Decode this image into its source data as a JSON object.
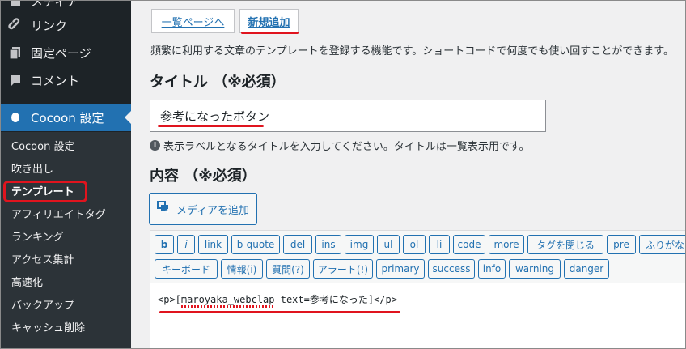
{
  "sidebar": {
    "menu": {
      "cut": "メディア",
      "link": "リンク",
      "page": "固定ページ",
      "comment": "コメント",
      "cocoon": "Cocoon 設定"
    },
    "submenu": [
      "Cocoon 設定",
      "吹き出し",
      "テンプレート",
      "アフィリエイトタグ",
      "ランキング",
      "アクセス集計",
      "高速化",
      "バックアップ",
      "キャッシュ削除"
    ]
  },
  "tabs": {
    "list": "一覧ページへ",
    "new": "新規追加"
  },
  "description": "頻繁に利用する文章のテンプレートを登録する機能です。ショートコードで何度でも使い回すことができます。",
  "title_field": {
    "heading": "タイトル （※必須）",
    "value": "参考になったボタン",
    "hint": "表示ラベルとなるタイトルを入力してください。タイトルは一覧表示用です。"
  },
  "content_field": {
    "heading": "内容 （※必須）",
    "media_button": "メディアを追加",
    "toolbar_row1": [
      "b",
      "i",
      "link",
      "b-quote",
      "del",
      "ins",
      "img",
      "ul",
      "ol",
      "li",
      "code",
      "more",
      "タグを閉じる",
      "pre",
      "ふりがな"
    ],
    "toolbar_row2": [
      "キーボード",
      "情報(i)",
      "質問(?)",
      "アラート(!)",
      "primary",
      "success",
      "info",
      "warning",
      "danger"
    ],
    "value": "<p>[maroyaka_webclap text=参考になった]</p>"
  },
  "colors": {
    "accent": "#2271b1",
    "highlight": "#e0141e",
    "sidebar": "#1d2327"
  }
}
